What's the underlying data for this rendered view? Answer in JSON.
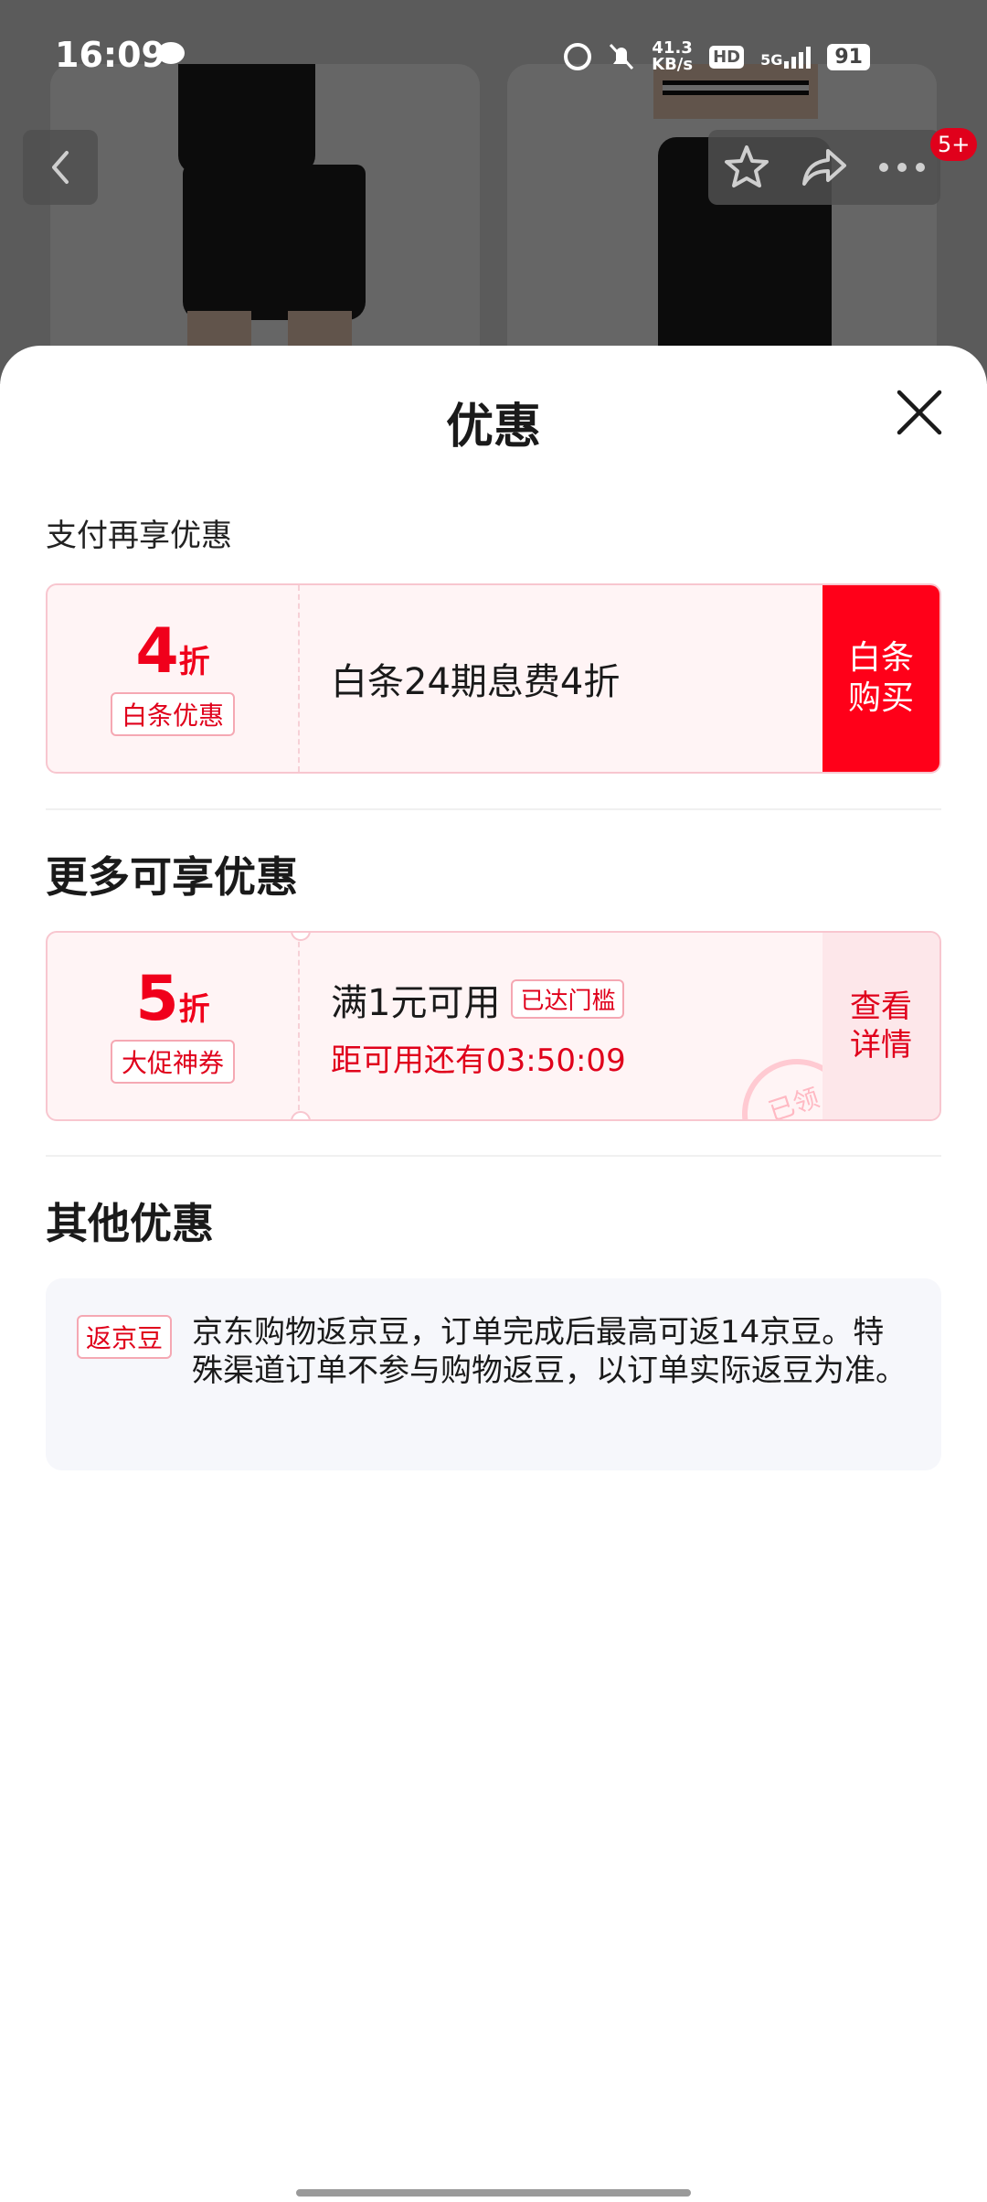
{
  "status_bar": {
    "time": "16:09",
    "net_speed_value": "41.3",
    "net_speed_unit": "KB/s",
    "hd_label": "HD",
    "network_label": "5G",
    "battery": "91"
  },
  "background": {
    "cart_badge": "5+"
  },
  "sheet": {
    "title": "优惠",
    "pay_section": {
      "label": "支付再享优惠",
      "coupon": {
        "discount_value": "4",
        "discount_unit": "折",
        "tag": "白条优惠",
        "description": "白条24期息费4折",
        "action_label": "白条购买"
      }
    },
    "more_section": {
      "label": "更多可享优惠",
      "coupon": {
        "discount_value": "5",
        "discount_unit": "折",
        "tag": "大促神券",
        "condition": "满1元可用",
        "threshold_badge": "已达门槛",
        "countdown": "距可用还有03:50:09",
        "action_label": "查看详情",
        "stamp": "已领"
      }
    },
    "other_section": {
      "label": "其他优惠",
      "tag": "返京豆",
      "text": "京东购物返京豆，订单完成后最高可返14京豆。特殊渠道订单不参与购物返豆，以订单实际返豆为准。"
    }
  },
  "colors": {
    "brand_red": "#ff0019",
    "coupon_bg": "#fff4f5",
    "info_bg": "#f6f7fb"
  }
}
